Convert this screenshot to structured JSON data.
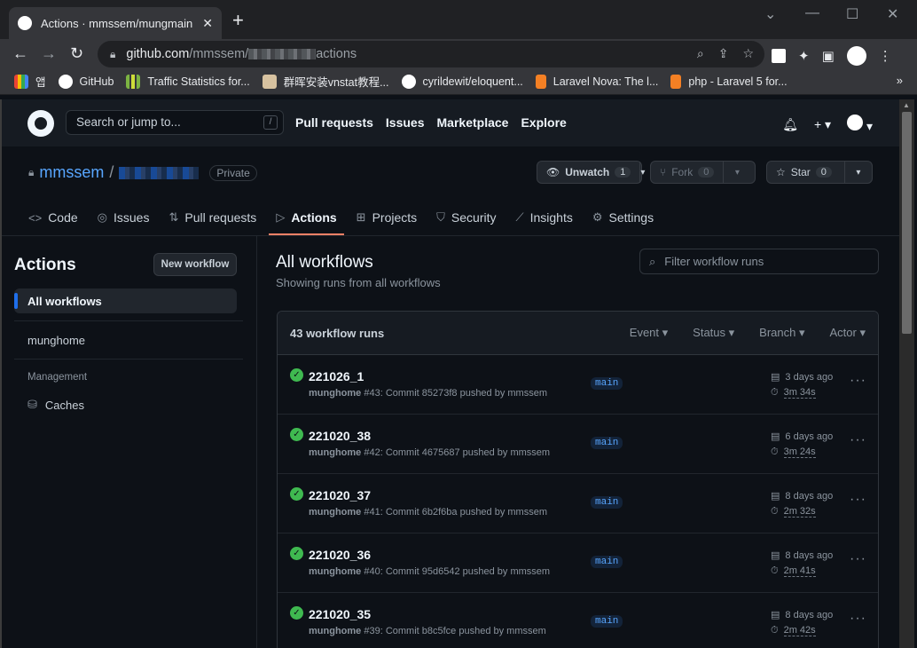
{
  "browser": {
    "tab_title": "Actions · mmssem/mungmain",
    "url_domain": "github.com",
    "url_path_prefix": "/mmssem/",
    "url_path_suffix": "actions",
    "bookmarks": [
      {
        "label": "앱",
        "icon": "apps-grid-icon",
        "color": "#ea4335"
      },
      {
        "label": "GitHub",
        "icon": "github-icon",
        "color": "#ffffff"
      },
      {
        "label": "Traffic Statistics for...",
        "icon": "chart-bars-icon",
        "color": "#7cb342"
      },
      {
        "label": "群晖安装vnstat教程...",
        "icon": "site-favicon",
        "color": "#d7c2a0"
      },
      {
        "label": "cyrildewit/eloquent...",
        "icon": "github-icon",
        "color": "#ffffff"
      },
      {
        "label": "Laravel Nova: The l...",
        "icon": "stackoverflow-icon",
        "color": "#f48024"
      },
      {
        "label": "php - Laravel 5 for...",
        "icon": "stackoverflow-icon",
        "color": "#f48024"
      }
    ]
  },
  "gh_header": {
    "search_placeholder": "Search or jump to...",
    "search_shortcut": "/",
    "nav": [
      "Pull requests",
      "Issues",
      "Marketplace",
      "Explore"
    ]
  },
  "repo": {
    "owner": "mmssem",
    "separator": "/",
    "visibility": "Private",
    "watch_label": "Unwatch",
    "watch_count": "1",
    "fork_label": "Fork",
    "fork_count": "0",
    "star_label": "Star",
    "star_count": "0",
    "tabs": [
      {
        "label": "Code",
        "icon": "code-icon"
      },
      {
        "label": "Issues",
        "icon": "issue-icon"
      },
      {
        "label": "Pull requests",
        "icon": "pull-request-icon"
      },
      {
        "label": "Actions",
        "icon": "play-icon",
        "active": true
      },
      {
        "label": "Projects",
        "icon": "table-icon"
      },
      {
        "label": "Security",
        "icon": "shield-icon"
      },
      {
        "label": "Insights",
        "icon": "graph-icon"
      },
      {
        "label": "Settings",
        "icon": "gear-icon"
      }
    ]
  },
  "sidebar": {
    "title": "Actions",
    "new_workflow": "New workflow",
    "all_workflows": "All workflows",
    "workflow": "munghome",
    "management_heading": "Management",
    "caches": "Caches"
  },
  "main": {
    "title": "All workflows",
    "subtitle": "Showing runs from all workflows",
    "filter_placeholder": "Filter workflow runs",
    "run_count": "43 workflow runs",
    "filters": [
      "Event",
      "Status",
      "Branch",
      "Actor"
    ],
    "runs": [
      {
        "title": "221026_1",
        "workflow": "munghome",
        "number": "#43",
        "desc": ": Commit 85273f8 pushed by mmssem",
        "branch": "main",
        "date": "3 days ago",
        "duration": "3m 34s"
      },
      {
        "title": "221020_38",
        "workflow": "munghome",
        "number": "#42",
        "desc": ": Commit 4675687 pushed by mmssem",
        "branch": "main",
        "date": "6 days ago",
        "duration": "3m 24s"
      },
      {
        "title": "221020_37",
        "workflow": "munghome",
        "number": "#41",
        "desc": ": Commit 6b2f6ba pushed by mmssem",
        "branch": "main",
        "date": "8 days ago",
        "duration": "2m 32s"
      },
      {
        "title": "221020_36",
        "workflow": "munghome",
        "number": "#40",
        "desc": ": Commit 95d6542 pushed by mmssem",
        "branch": "main",
        "date": "8 days ago",
        "duration": "2m 41s"
      },
      {
        "title": "221020_35",
        "workflow": "munghome",
        "number": "#39",
        "desc": ": Commit b8c5fce pushed by mmssem",
        "branch": "main",
        "date": "8 days ago",
        "duration": "2m 42s"
      }
    ]
  },
  "colors": {
    "accent": "#1f6feb",
    "active_tab_underline": "#f78166",
    "success": "#3fb950",
    "link": "#58a6ff"
  }
}
